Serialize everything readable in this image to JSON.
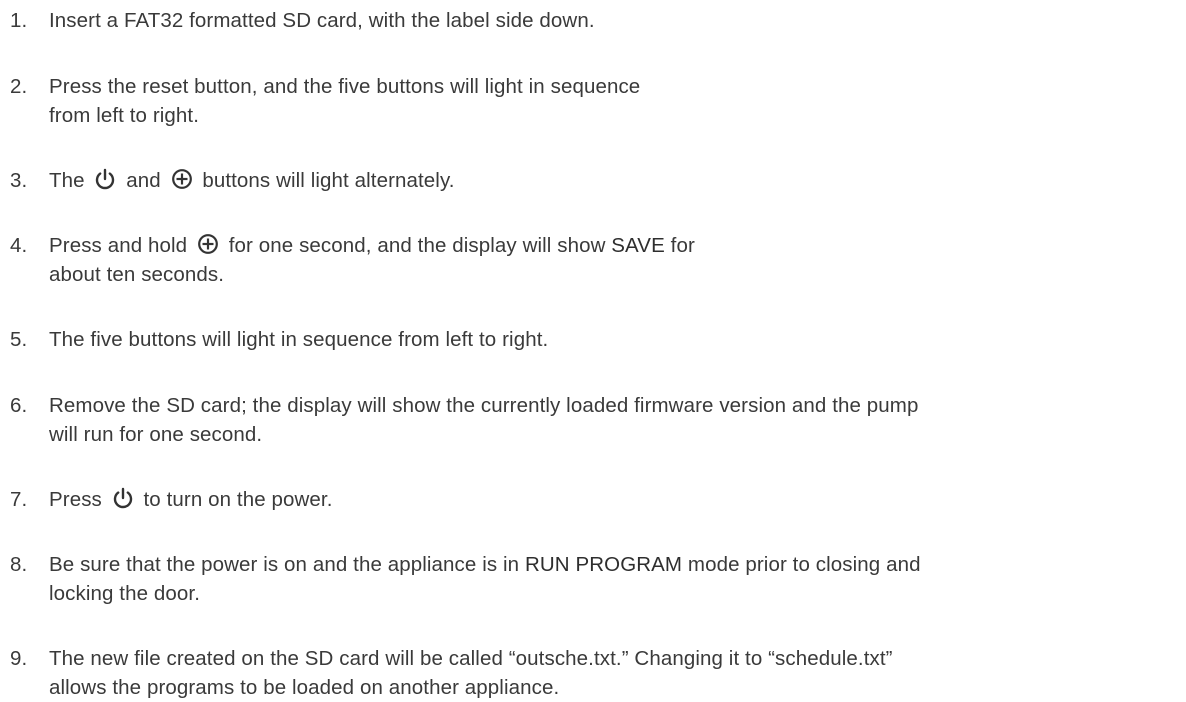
{
  "steps": [
    {
      "number": "1.",
      "lines": [
        "Insert a FAT32 formatted SD card, with the label side down."
      ]
    },
    {
      "number": "2.",
      "lines": [
        "Press the reset button, and the five buttons will light in sequence",
        "from left to right."
      ]
    },
    {
      "number": "3.",
      "text_a": "The",
      "text_b": "and",
      "text_c": "buttons will light alternately."
    },
    {
      "number": "4.",
      "text_a": "Press and hold",
      "text_b": "for one second, and the display will show",
      "emphasis": "SAVE",
      "text_c": "for",
      "line2": "about ten seconds."
    },
    {
      "number": "5.",
      "lines": [
        "The five buttons will light in sequence from left to right."
      ]
    },
    {
      "number": "6.",
      "lines": [
        "Remove the SD card; the display will show the currently loaded firmware version and the pump",
        "will run for one second."
      ]
    },
    {
      "number": "7.",
      "text_a": "Press",
      "text_b": "to turn on the power."
    },
    {
      "number": "8.",
      "text_a": "Be sure that the power is on and the appliance is in",
      "emphasis": "RUN PROGRAM",
      "text_b": "mode prior to closing and",
      "line2": "locking the door."
    },
    {
      "number": "9.",
      "lines": [
        "The new file created on the SD card will be called “outsche.txt.” Changing it to “schedule.txt”",
        "allows the programs to be loaded on another appliance."
      ]
    }
  ],
  "icons": {
    "power": "power-icon",
    "plus": "circled-plus-icon"
  },
  "colors": {
    "text": "#3a3a3a"
  }
}
